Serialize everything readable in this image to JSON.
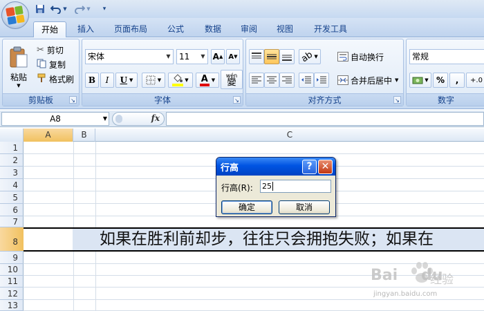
{
  "tabs": [
    "开始",
    "插入",
    "页面布局",
    "公式",
    "数据",
    "审阅",
    "视图",
    "开发工具"
  ],
  "active_tab": "开始",
  "clipboard": {
    "paste_label": "粘贴",
    "cut_label": "剪切",
    "copy_label": "复制",
    "format_painter_label": "格式刷",
    "group_label": "剪贴板"
  },
  "font": {
    "name": "宋体",
    "size": "11",
    "group_label": "字体",
    "bold_label": "B",
    "italic_label": "I",
    "underline_label": "U",
    "font_color_glyph": "A",
    "grow_label": "A",
    "shrink_label": "A",
    "phonetic_label": "wén",
    "phonetic_char": "變"
  },
  "alignment": {
    "wrap_label": "自动换行",
    "merge_label": "合并后居中",
    "group_label": "对齐方式"
  },
  "number": {
    "format": "常规",
    "percent_label": "%",
    "comma_label": ",",
    "group_label": "数字",
    "decimal_label": "+.0"
  },
  "formula_bar": {
    "name_box": "A8",
    "fx_label": "fx"
  },
  "columns": [
    "A",
    "B",
    "C"
  ],
  "rows": [
    "1",
    "2",
    "3",
    "4",
    "5",
    "6",
    "7",
    "8",
    "9",
    "10",
    "11",
    "12",
    "13"
  ],
  "row8_text": "如果在胜利前却步，往往只会拥抱失败；如果在",
  "dialog": {
    "title": "行高",
    "help_label": "?",
    "close_label": "✕",
    "field_label": "行高(R):",
    "field_value": "25",
    "ok_label": "确定",
    "cancel_label": "取消"
  },
  "watermark": {
    "brand": "Bai",
    "brand2": "du",
    "sub": "经验",
    "url": "jingyan.baidu.com"
  },
  "colors": {
    "ribbon_text": "#15428b",
    "selection_header": "#f1c15f",
    "dialog_title": "#0054e3"
  }
}
